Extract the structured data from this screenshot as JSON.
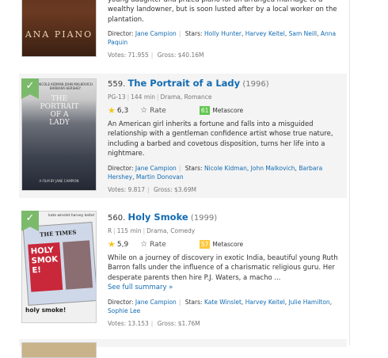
{
  "items": [
    {
      "poster_text": "ANA PIANO",
      "description_tail": "young daughter and prized piano for an arranged marriage to a wealthy landowner, but is soon lusted after by a local worker on the plantation.",
      "director_label": "Director:",
      "director": "Jane Campion",
      "stars_label": "Stars:",
      "stars": [
        "Holly Hunter",
        "Harvey Keitel",
        "Sam Neill",
        "Anna Paquin"
      ],
      "votes_label": "Votes:",
      "votes": "71.955",
      "gross_label": "Gross:",
      "gross": "$40.16M"
    },
    {
      "rank": "559.",
      "title": "The Portrait of a Lady",
      "year": "(1996)",
      "certificate": "PG-13",
      "runtime": "144 min",
      "genre": "Drama, Romance",
      "rating": "6,3",
      "rate_label": "Rate",
      "metascore": "61",
      "metascore_color": "#61c74f",
      "metascore_label": "Metascore",
      "description": "An American girl inherits a fortune and falls into a misguided relationship with a gentleman confidence artist whose true nature, including a barbed and covetous disposition, turns her life into a nightmare.",
      "director_label": "Director:",
      "director": "Jane Campion",
      "stars_label": "Stars:",
      "stars": [
        "Nicole Kidman",
        "John Malkovich",
        "Barbara Hershey",
        "Martin Donovan"
      ],
      "votes_label": "Votes:",
      "votes": "9.817",
      "gross_label": "Gross:",
      "gross": "$3.69M",
      "poster_top": "NICOLE KIDMAN   JOHN MALKOVICH   BARBARA HERSHEY",
      "poster_title": "THE PORTRAIT OF A LADY",
      "poster_credit": "A FILM BY JANE CAMPION"
    },
    {
      "rank": "560.",
      "title": "Holy Smoke",
      "year": "(1999)",
      "certificate": "R",
      "runtime": "115 min",
      "genre": "Drama, Comedy",
      "rating": "5,9",
      "rate_label": "Rate",
      "metascore": "57",
      "metascore_color": "#fdc73d",
      "metascore_label": "Metascore",
      "description": "While on a journey of discovery in exotic India, beautiful young Ruth Barron falls under the influence of a charismatic religious guru. Her desperate parents then hire P.J. Waters, a macho ...",
      "see_full": "See full summary »",
      "director_label": "Director:",
      "director": "Jane Campion",
      "stars_label": "Stars:",
      "stars": [
        "Kate Winslet",
        "Harvey Keitel",
        "Julie Hamilton",
        "Sophie Lee"
      ],
      "votes_label": "Votes:",
      "votes": "13.153",
      "gross_label": "Gross:",
      "gross": "$1.76M",
      "poster_top": "kate winslet   harvey keitel",
      "poster_paper": "HOLY SMOKE!",
      "poster_masthead": "THE TIMES",
      "poster_bottom": "holy smoke!"
    }
  ],
  "colors": {
    "link": "#136cb2",
    "ribbon": "#7cba6b",
    "star": "#f5c518"
  }
}
